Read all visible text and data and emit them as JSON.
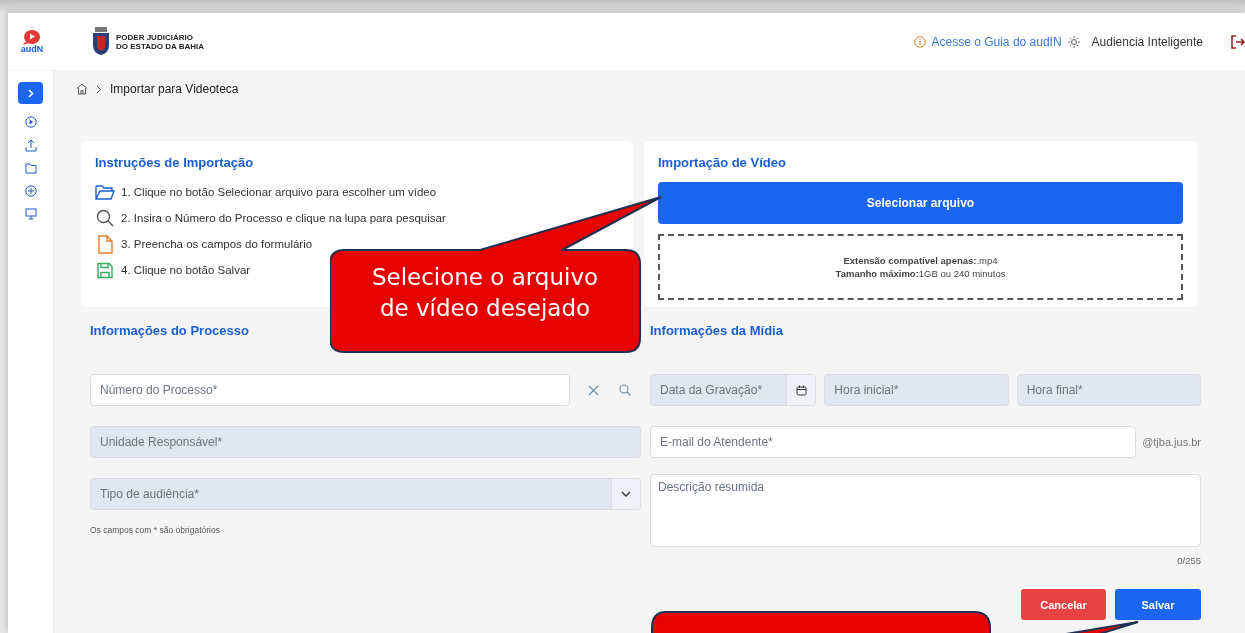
{
  "header": {
    "logo_text": "audN",
    "org_line_1": "PODER JUDICIÁRIO",
    "org_line_2": "DO ESTADO DA BAHIA",
    "guide_link": "Acesse o Guia do audIN",
    "app_name": "Audiencia Inteligente"
  },
  "breadcrumb": {
    "current": "Importar para Videoteca"
  },
  "instructions": {
    "title": "Instruções de Importação",
    "steps": [
      {
        "kind": "folder",
        "text": "1. Clique no botão Selecionar arquivo para escolher um vídeo"
      },
      {
        "kind": "search",
        "text": "2. Insira o Número do Processo e clique na lupa para pesquisar"
      },
      {
        "kind": "file",
        "text": "3. Preencha os campos do formulário"
      },
      {
        "kind": "save",
        "text": "4. Clique no botão Salvar"
      }
    ]
  },
  "video_import": {
    "title": "Importação de Vídeo",
    "button": "Selecionar arquivo",
    "info": [
      "**Extensão compatível apenas:**.mp4",
      "**Tamanho máximo:**1GB ou 240 minutos"
    ]
  },
  "process_info": {
    "title": "Informações do Processo",
    "fields": [
      {
        "kind": "search",
        "placeholder": "Número do Processo*",
        "disabled": false
      },
      {
        "kind": "text",
        "placeholder": "Unidade Responsável*",
        "disabled": true
      },
      {
        "kind": "select",
        "placeholder": "Tipo de audiência*",
        "disabled": true
      }
    ],
    "hint": "Os campos com * são obrigatórios"
  },
  "media_info": {
    "title": "Informações da Mídia",
    "time_fields": [
      {
        "kind": "date",
        "placeholder": "Data da Gravação*",
        "disabled": true
      },
      {
        "kind": "text",
        "placeholder": "Hora inicial*",
        "disabled": true
      },
      {
        "kind": "text",
        "placeholder": "Hora final*",
        "disabled": true
      }
    ],
    "email": {
      "placeholder": "E-mail do Atendente*",
      "suffix": "@tjba.jus.br",
      "disabled": false
    },
    "description": {
      "placeholder": "Descrição resumida",
      "counter": "0/255"
    }
  },
  "actions": [
    {
      "kind": "cancel",
      "label": "Cancelar"
    },
    {
      "kind": "save",
      "label": "Salvar"
    }
  ],
  "callouts": [
    {
      "kind": "top",
      "text": "Selecione o arquivo de vídeo desejado"
    },
    {
      "kind": "bottom"
    }
  ]
}
